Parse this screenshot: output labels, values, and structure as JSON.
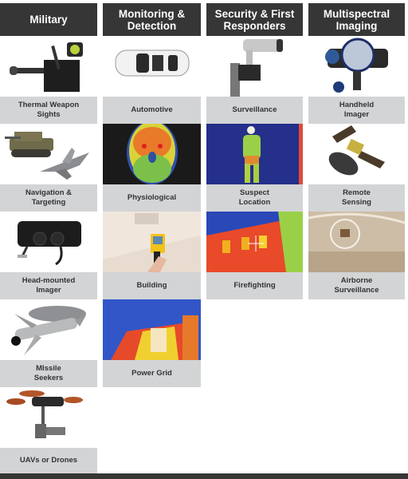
{
  "colors": {
    "header_bg": "#363636",
    "label_bg": "#d3d4d6",
    "header_text": "#ffffff",
    "label_text": "#333333"
  },
  "columns": [
    {
      "title": "Military",
      "items": [
        {
          "label": "Thermal Weapon\nSights",
          "icon": "rifle-scope-icon"
        },
        {
          "label": "Navigation &\nTargeting",
          "icon": "tank-jet-icon"
        },
        {
          "label": "Head-mounted\nImager",
          "icon": "head-mounted-imager-icon"
        },
        {
          "label": "MIssile\nSeekers",
          "icon": "missile-icon"
        },
        {
          "label": "UAVs or Drones",
          "icon": "drone-icon"
        }
      ]
    },
    {
      "title": "Monitoring &\nDetection",
      "items": [
        {
          "label": "Automotive",
          "icon": "car-icon"
        },
        {
          "label": "Physiological",
          "icon": "thermal-face-icon"
        },
        {
          "label": "Building",
          "icon": "thermal-camera-ceiling-icon"
        },
        {
          "label": "Power Grid",
          "icon": "thermal-transformer-icon"
        }
      ]
    },
    {
      "title": "Security & First\nResponders",
      "items": [
        {
          "label": "Surveillance",
          "icon": "security-camera-icon"
        },
        {
          "label": "Suspect\nLocation",
          "icon": "thermal-person-icon"
        },
        {
          "label": "Firefighting",
          "icon": "thermal-building-icon"
        }
      ]
    },
    {
      "title": "Multispectral\nImaging",
      "items": [
        {
          "label": "Handheld\nImager",
          "icon": "handheld-imager-icon"
        },
        {
          "label": "Remote\nSensing",
          "icon": "satellite-icon"
        },
        {
          "label": "Airborne\nSurveillance",
          "icon": "aerial-city-icon"
        }
      ]
    }
  ]
}
